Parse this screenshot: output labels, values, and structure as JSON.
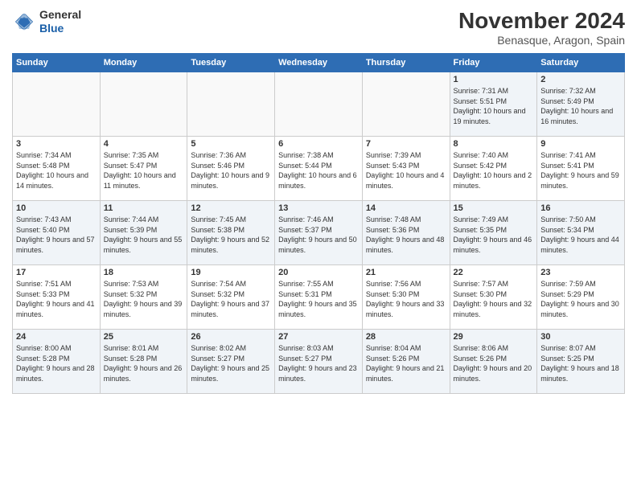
{
  "header": {
    "logo_general": "General",
    "logo_blue": "Blue",
    "month_title": "November 2024",
    "location": "Benasque, Aragon, Spain"
  },
  "days_of_week": [
    "Sunday",
    "Monday",
    "Tuesday",
    "Wednesday",
    "Thursday",
    "Friday",
    "Saturday"
  ],
  "weeks": [
    [
      {
        "day": "",
        "info": ""
      },
      {
        "day": "",
        "info": ""
      },
      {
        "day": "",
        "info": ""
      },
      {
        "day": "",
        "info": ""
      },
      {
        "day": "",
        "info": ""
      },
      {
        "day": "1",
        "info": "Sunrise: 7:31 AM\nSunset: 5:51 PM\nDaylight: 10 hours and 19 minutes."
      },
      {
        "day": "2",
        "info": "Sunrise: 7:32 AM\nSunset: 5:49 PM\nDaylight: 10 hours and 16 minutes."
      }
    ],
    [
      {
        "day": "3",
        "info": "Sunrise: 7:34 AM\nSunset: 5:48 PM\nDaylight: 10 hours and 14 minutes."
      },
      {
        "day": "4",
        "info": "Sunrise: 7:35 AM\nSunset: 5:47 PM\nDaylight: 10 hours and 11 minutes."
      },
      {
        "day": "5",
        "info": "Sunrise: 7:36 AM\nSunset: 5:46 PM\nDaylight: 10 hours and 9 minutes."
      },
      {
        "day": "6",
        "info": "Sunrise: 7:38 AM\nSunset: 5:44 PM\nDaylight: 10 hours and 6 minutes."
      },
      {
        "day": "7",
        "info": "Sunrise: 7:39 AM\nSunset: 5:43 PM\nDaylight: 10 hours and 4 minutes."
      },
      {
        "day": "8",
        "info": "Sunrise: 7:40 AM\nSunset: 5:42 PM\nDaylight: 10 hours and 2 minutes."
      },
      {
        "day": "9",
        "info": "Sunrise: 7:41 AM\nSunset: 5:41 PM\nDaylight: 9 hours and 59 minutes."
      }
    ],
    [
      {
        "day": "10",
        "info": "Sunrise: 7:43 AM\nSunset: 5:40 PM\nDaylight: 9 hours and 57 minutes."
      },
      {
        "day": "11",
        "info": "Sunrise: 7:44 AM\nSunset: 5:39 PM\nDaylight: 9 hours and 55 minutes."
      },
      {
        "day": "12",
        "info": "Sunrise: 7:45 AM\nSunset: 5:38 PM\nDaylight: 9 hours and 52 minutes."
      },
      {
        "day": "13",
        "info": "Sunrise: 7:46 AM\nSunset: 5:37 PM\nDaylight: 9 hours and 50 minutes."
      },
      {
        "day": "14",
        "info": "Sunrise: 7:48 AM\nSunset: 5:36 PM\nDaylight: 9 hours and 48 minutes."
      },
      {
        "day": "15",
        "info": "Sunrise: 7:49 AM\nSunset: 5:35 PM\nDaylight: 9 hours and 46 minutes."
      },
      {
        "day": "16",
        "info": "Sunrise: 7:50 AM\nSunset: 5:34 PM\nDaylight: 9 hours and 44 minutes."
      }
    ],
    [
      {
        "day": "17",
        "info": "Sunrise: 7:51 AM\nSunset: 5:33 PM\nDaylight: 9 hours and 41 minutes."
      },
      {
        "day": "18",
        "info": "Sunrise: 7:53 AM\nSunset: 5:32 PM\nDaylight: 9 hours and 39 minutes."
      },
      {
        "day": "19",
        "info": "Sunrise: 7:54 AM\nSunset: 5:32 PM\nDaylight: 9 hours and 37 minutes."
      },
      {
        "day": "20",
        "info": "Sunrise: 7:55 AM\nSunset: 5:31 PM\nDaylight: 9 hours and 35 minutes."
      },
      {
        "day": "21",
        "info": "Sunrise: 7:56 AM\nSunset: 5:30 PM\nDaylight: 9 hours and 33 minutes."
      },
      {
        "day": "22",
        "info": "Sunrise: 7:57 AM\nSunset: 5:30 PM\nDaylight: 9 hours and 32 minutes."
      },
      {
        "day": "23",
        "info": "Sunrise: 7:59 AM\nSunset: 5:29 PM\nDaylight: 9 hours and 30 minutes."
      }
    ],
    [
      {
        "day": "24",
        "info": "Sunrise: 8:00 AM\nSunset: 5:28 PM\nDaylight: 9 hours and 28 minutes."
      },
      {
        "day": "25",
        "info": "Sunrise: 8:01 AM\nSunset: 5:28 PM\nDaylight: 9 hours and 26 minutes."
      },
      {
        "day": "26",
        "info": "Sunrise: 8:02 AM\nSunset: 5:27 PM\nDaylight: 9 hours and 25 minutes."
      },
      {
        "day": "27",
        "info": "Sunrise: 8:03 AM\nSunset: 5:27 PM\nDaylight: 9 hours and 23 minutes."
      },
      {
        "day": "28",
        "info": "Sunrise: 8:04 AM\nSunset: 5:26 PM\nDaylight: 9 hours and 21 minutes."
      },
      {
        "day": "29",
        "info": "Sunrise: 8:06 AM\nSunset: 5:26 PM\nDaylight: 9 hours and 20 minutes."
      },
      {
        "day": "30",
        "info": "Sunrise: 8:07 AM\nSunset: 5:25 PM\nDaylight: 9 hours and 18 minutes."
      }
    ]
  ]
}
